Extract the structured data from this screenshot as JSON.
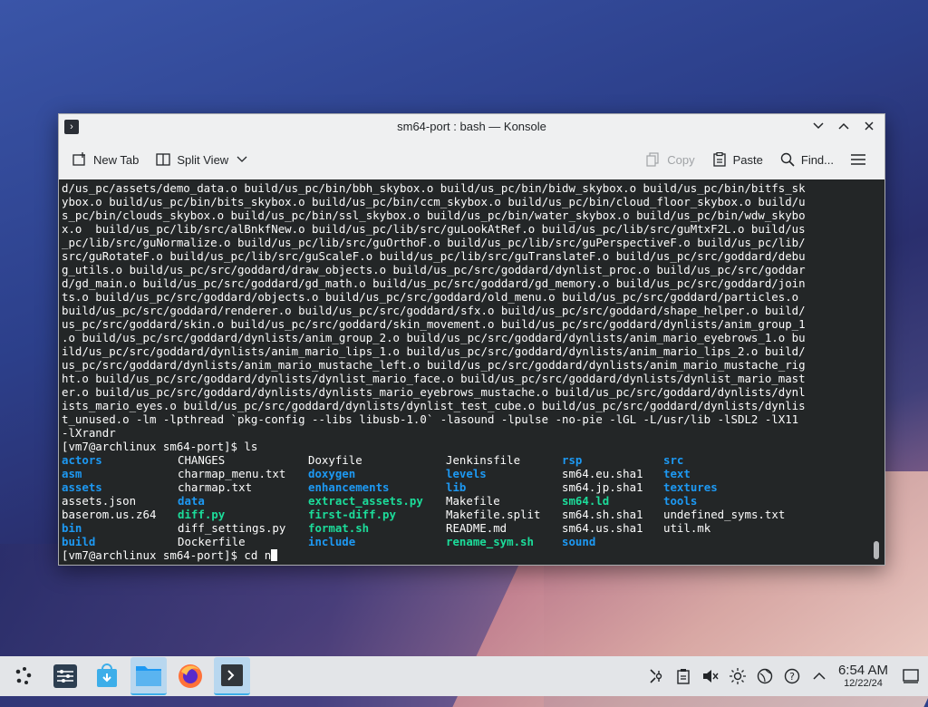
{
  "window": {
    "title": "sm64-port : bash — Konsole"
  },
  "toolbar": {
    "new_tab": "New Tab",
    "split_view": "Split View",
    "copy": "Copy",
    "paste": "Paste",
    "find": "Find..."
  },
  "terminal": {
    "lines": [
      "d/us_pc/assets/demo_data.o build/us_pc/bin/bbh_skybox.o build/us_pc/bin/bidw_skybox.o build/us_pc/bin/bitfs_sk",
      "ybox.o build/us_pc/bin/bits_skybox.o build/us_pc/bin/ccm_skybox.o build/us_pc/bin/cloud_floor_skybox.o build/u",
      "s_pc/bin/clouds_skybox.o build/us_pc/bin/ssl_skybox.o build/us_pc/bin/water_skybox.o build/us_pc/bin/wdw_skybo",
      "x.o  build/us_pc/lib/src/alBnkfNew.o build/us_pc/lib/src/guLookAtRef.o build/us_pc/lib/src/guMtxF2L.o build/us",
      "_pc/lib/src/guNormalize.o build/us_pc/lib/src/guOrthoF.o build/us_pc/lib/src/guPerspectiveF.o build/us_pc/lib/",
      "src/guRotateF.o build/us_pc/lib/src/guScaleF.o build/us_pc/lib/src/guTranslateF.o build/us_pc/src/goddard/debu",
      "g_utils.o build/us_pc/src/goddard/draw_objects.o build/us_pc/src/goddard/dynlist_proc.o build/us_pc/src/goddar",
      "d/gd_main.o build/us_pc/src/goddard/gd_math.o build/us_pc/src/goddard/gd_memory.o build/us_pc/src/goddard/join",
      "ts.o build/us_pc/src/goddard/objects.o build/us_pc/src/goddard/old_menu.o build/us_pc/src/goddard/particles.o",
      "build/us_pc/src/goddard/renderer.o build/us_pc/src/goddard/sfx.o build/us_pc/src/goddard/shape_helper.o build/",
      "us_pc/src/goddard/skin.o build/us_pc/src/goddard/skin_movement.o build/us_pc/src/goddard/dynlists/anim_group_1",
      ".o build/us_pc/src/goddard/dynlists/anim_group_2.o build/us_pc/src/goddard/dynlists/anim_mario_eyebrows_1.o bu",
      "ild/us_pc/src/goddard/dynlists/anim_mario_lips_1.o build/us_pc/src/goddard/dynlists/anim_mario_lips_2.o build/",
      "us_pc/src/goddard/dynlists/anim_mario_mustache_left.o build/us_pc/src/goddard/dynlists/anim_mario_mustache_rig",
      "ht.o build/us_pc/src/goddard/dynlists/dynlist_mario_face.o build/us_pc/src/goddard/dynlists/dynlist_mario_mast",
      "er.o build/us_pc/src/goddard/dynlists/dynlists_mario_eyebrows_mustache.o build/us_pc/src/goddard/dynlists/dynl",
      "ists_mario_eyes.o build/us_pc/src/goddard/dynlists/dynlist_test_cube.o build/us_pc/src/goddard/dynlists/dynlis",
      "t_unused.o -lm -lpthread `pkg-config --libs libusb-1.0` -lasound -lpulse -no-pie -lGL -L/usr/lib -lSDL2 -lX11",
      "-lXrandr",
      "[vm7@archlinux sm64-port]$ ls"
    ],
    "ls_rows": [
      [
        {
          "t": "actors",
          "c": "dir"
        },
        {
          "t": "CHANGES",
          "c": "plain"
        },
        {
          "t": "Doxyfile",
          "c": "plain"
        },
        {
          "t": "Jenkinsfile",
          "c": "plain"
        },
        {
          "t": "rsp",
          "c": "dir"
        },
        {
          "t": "src",
          "c": "dir"
        }
      ],
      [
        {
          "t": "asm",
          "c": "dir"
        },
        {
          "t": "charmap_menu.txt",
          "c": "plain"
        },
        {
          "t": "doxygen",
          "c": "dir"
        },
        {
          "t": "levels",
          "c": "dir"
        },
        {
          "t": "sm64.eu.sha1",
          "c": "plain"
        },
        {
          "t": "text",
          "c": "dir"
        }
      ],
      [
        {
          "t": "assets",
          "c": "dir"
        },
        {
          "t": "charmap.txt",
          "c": "plain"
        },
        {
          "t": "enhancements",
          "c": "dir"
        },
        {
          "t": "lib",
          "c": "dir"
        },
        {
          "t": "sm64.jp.sha1",
          "c": "plain"
        },
        {
          "t": "textures",
          "c": "dir"
        }
      ],
      [
        {
          "t": "assets.json",
          "c": "plain"
        },
        {
          "t": "data",
          "c": "dir"
        },
        {
          "t": "extract_assets.py",
          "c": "exe"
        },
        {
          "t": "Makefile",
          "c": "plain"
        },
        {
          "t": "sm64.ld",
          "c": "exe"
        },
        {
          "t": "tools",
          "c": "dir"
        }
      ],
      [
        {
          "t": "baserom.us.z64",
          "c": "plain"
        },
        {
          "t": "diff.py",
          "c": "exe"
        },
        {
          "t": "first-diff.py",
          "c": "exe"
        },
        {
          "t": "Makefile.split",
          "c": "plain"
        },
        {
          "t": "sm64.sh.sha1",
          "c": "plain"
        },
        {
          "t": "undefined_syms.txt",
          "c": "plain"
        }
      ],
      [
        {
          "t": "bin",
          "c": "dir"
        },
        {
          "t": "diff_settings.py",
          "c": "plain"
        },
        {
          "t": "format.sh",
          "c": "exe"
        },
        {
          "t": "README.md",
          "c": "plain"
        },
        {
          "t": "sm64.us.sha1",
          "c": "plain"
        },
        {
          "t": "util.mk",
          "c": "plain"
        }
      ],
      [
        {
          "t": "build",
          "c": "dir"
        },
        {
          "t": "Dockerfile",
          "c": "plain"
        },
        {
          "t": "include",
          "c": "dir"
        },
        {
          "t": "rename_sym.sh",
          "c": "exe"
        },
        {
          "t": "sound",
          "c": "dir"
        },
        {
          "t": "",
          "c": "plain"
        }
      ]
    ],
    "prompt": "[vm7@archlinux sm64-port]$ cd n"
  },
  "taskbar": {
    "time": "6:54 AM",
    "date": "12/22/24"
  },
  "colors": {
    "terminal_bg": "#232627",
    "dir": "#1d99f3",
    "exe": "#1cdc9a",
    "accent": "#3daee9"
  }
}
